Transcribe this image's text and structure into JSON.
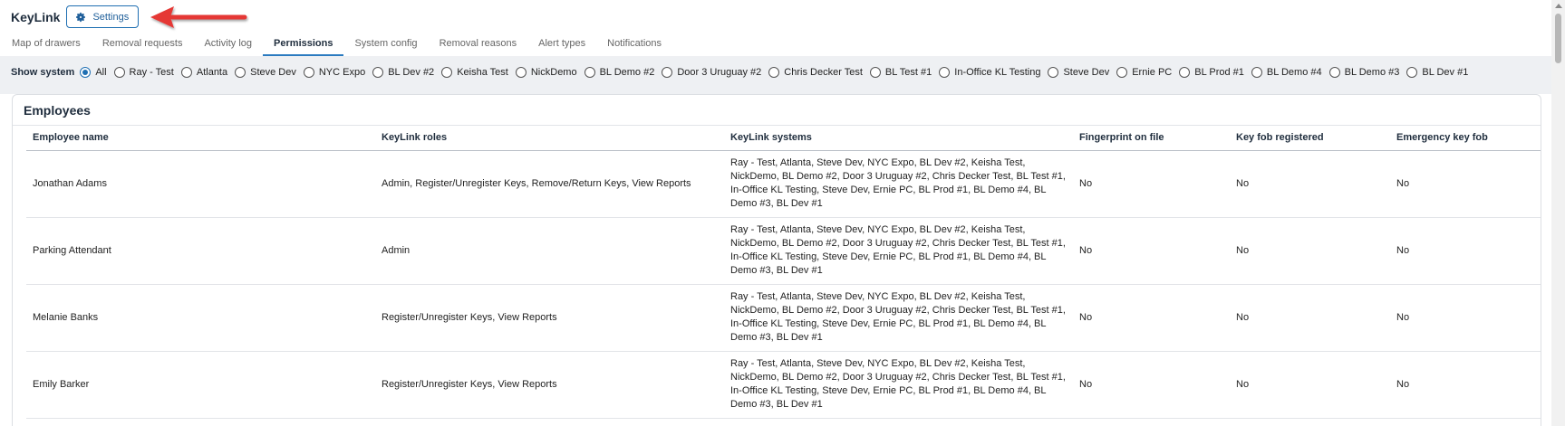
{
  "header": {
    "title": "KeyLink",
    "settings_label": "Settings"
  },
  "tabs": [
    {
      "label": "Map of drawers",
      "active": false
    },
    {
      "label": "Removal requests",
      "active": false
    },
    {
      "label": "Activity log",
      "active": false
    },
    {
      "label": "Permissions",
      "active": true
    },
    {
      "label": "System config",
      "active": false
    },
    {
      "label": "Removal reasons",
      "active": false
    },
    {
      "label": "Alert types",
      "active": false
    },
    {
      "label": "Notifications",
      "active": false
    }
  ],
  "system_filter": {
    "label": "Show system",
    "options": [
      "All",
      "Ray - Test",
      "Atlanta",
      "Steve Dev",
      "NYC Expo",
      "BL Dev #2",
      "Keisha Test",
      "NickDemo",
      "BL Demo #2",
      "Door 3 Uruguay #2",
      "Chris Decker Test",
      "BL Test #1",
      "In-Office KL Testing",
      "Steve Dev",
      "Ernie PC",
      "BL Prod #1",
      "BL Demo #4",
      "BL Demo #3",
      "BL Dev #1"
    ],
    "selected": "All"
  },
  "employees": {
    "title": "Employees",
    "columns": [
      "Employee name",
      "KeyLink roles",
      "KeyLink systems",
      "Fingerprint on file",
      "Key fob registered",
      "Emergency key fob"
    ],
    "rows": [
      {
        "name": "Jonathan Adams",
        "roles": "Admin, Register/Unregister Keys, Remove/Return Keys, View Reports",
        "systems": "Ray - Test, Atlanta, Steve Dev, NYC Expo, BL Dev #2, Keisha Test, NickDemo, BL Demo #2, Door 3 Uruguay #2, Chris Decker Test, BL Test #1, In-Office KL Testing, Steve Dev, Ernie PC, BL Prod #1, BL Demo #4, BL Demo #3, BL Dev #1",
        "fingerprint": "No",
        "key_fob": "No",
        "emergency_fob": "No"
      },
      {
        "name": "Parking Attendant",
        "roles": "Admin",
        "systems": "Ray - Test, Atlanta, Steve Dev, NYC Expo, BL Dev #2, Keisha Test, NickDemo, BL Demo #2, Door 3 Uruguay #2, Chris Decker Test, BL Test #1, In-Office KL Testing, Steve Dev, Ernie PC, BL Prod #1, BL Demo #4, BL Demo #3, BL Dev #1",
        "fingerprint": "No",
        "key_fob": "No",
        "emergency_fob": "No"
      },
      {
        "name": "Melanie Banks",
        "roles": "Register/Unregister Keys, View Reports",
        "systems": "Ray - Test, Atlanta, Steve Dev, NYC Expo, BL Dev #2, Keisha Test, NickDemo, BL Demo #2, Door 3 Uruguay #2, Chris Decker Test, BL Test #1, In-Office KL Testing, Steve Dev, Ernie PC, BL Prod #1, BL Demo #4, BL Demo #3, BL Dev #1",
        "fingerprint": "No",
        "key_fob": "No",
        "emergency_fob": "No"
      },
      {
        "name": "Emily Barker",
        "roles": "Register/Unregister Keys, View Reports",
        "systems": "Ray - Test, Atlanta, Steve Dev, NYC Expo, BL Dev #2, Keisha Test, NickDemo, BL Demo #2, Door 3 Uruguay #2, Chris Decker Test, BL Test #1, In-Office KL Testing, Steve Dev, Ernie PC, BL Prod #1, BL Demo #4, BL Demo #3, BL Dev #1",
        "fingerprint": "No",
        "key_fob": "No",
        "emergency_fob": "No"
      }
    ]
  },
  "colors": {
    "accent": "#1f6fb2",
    "annotation_arrow": "#e53935",
    "filter_bg": "#eef0f3"
  },
  "icons": {
    "settings": "gear-icon",
    "annotation": "red-arrow-icon"
  }
}
